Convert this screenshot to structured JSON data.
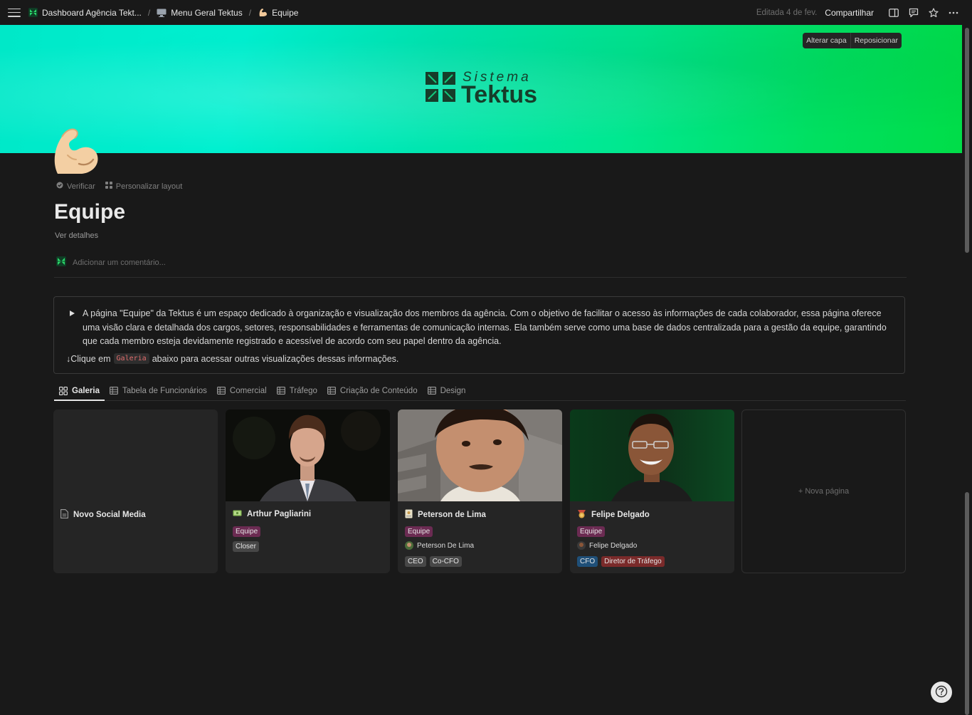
{
  "topbar": {
    "breadcrumbs": [
      "Dashboard Agência Tekt...",
      "Menu Geral Tektus",
      "Equipe"
    ],
    "separator": "/",
    "edited": "Editada 4 de fev.",
    "share": "Compartilhar"
  },
  "cover": {
    "change_cover": "Alterar capa",
    "reposition": "Reposicionar",
    "logo_small": "Sistema",
    "logo_big": "Tektus"
  },
  "page": {
    "verify": "Verificar",
    "customize_layout": "Personalizar layout",
    "title": "Equipe",
    "details": "Ver detalhes",
    "comment_placeholder": "Adicionar um comentário..."
  },
  "callout": {
    "text": "A página \"Equipe\" da Tektus é um espaço dedicado à organização e visualização dos membros da agência. Com o objetivo de facilitar o acesso às informações de cada colaborador, essa página oferece uma visão clara e detalhada dos cargos, setores, responsabilidades e ferramentas de comunicação internas. Ela também serve como uma base de dados centralizada para a gestão da equipe, garantindo que cada membro esteja devidamente registrado e acessível de acordo com seu papel dentro da agência.",
    "line2_prefix": "↓Clique em",
    "line2_code": "Galeria",
    "line2_suffix": "abaixo para acessar outras visualizações dessas informações."
  },
  "tabs": [
    "Galeria",
    "Tabela de Funcionários",
    "Comercial",
    "Tráfego",
    "Criação de Conteúdo",
    "Design"
  ],
  "cards": [
    {
      "name": "Novo Social Media"
    },
    {
      "name": "Arthur Pagliarini",
      "tags1": [
        "Equipe"
      ],
      "tags2": [
        "Closer"
      ]
    },
    {
      "name": "Peterson de Lima",
      "tags1": [
        "Equipe"
      ],
      "person": "Peterson De Lima",
      "tags2": [
        "CEO",
        "Co-CFO"
      ]
    },
    {
      "name": "Felipe Delgado",
      "tags1": [
        "Equipe"
      ],
      "person": "Felipe Delgado",
      "tags2": [
        "CFO",
        "Diretor de Tráfego"
      ]
    }
  ],
  "new_page": "+ Nova página",
  "colors": {
    "background": "#191919",
    "cover_start": "#00e8c8",
    "cover_end": "#00dd48",
    "tag_equipe": "#6b2b52",
    "tag_blue": "#1f4f78",
    "tag_red": "#7a2a2a"
  }
}
